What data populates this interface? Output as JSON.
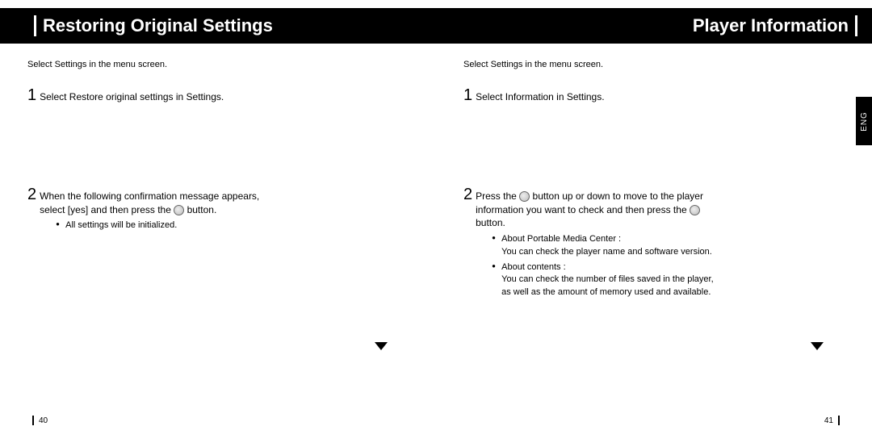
{
  "header": {
    "left_title": "Restoring Original Settings",
    "right_title": "Player Information"
  },
  "side_tab": "ENG",
  "left_page": {
    "intro": "Select Settings in the menu screen.",
    "step1_num": "1",
    "step1_text": "Select Restore original settings in Settings.",
    "step2_num": "2",
    "step2_text_a": "When the following confirmation message appears, select [yes] and then press the",
    "step2_text_b": "button.",
    "bullet1": "All settings will be initialized.",
    "pagenum": "40"
  },
  "right_page": {
    "intro": "Select Settings in the menu screen.",
    "step1_num": "1",
    "step1_text": "Select Information in Settings.",
    "step2_num": "2",
    "step2_text_a": "Press the",
    "step2_text_b": "button up or down to move to the player information you want to check and then press the",
    "step2_text_c": "button.",
    "bullet1_title": "About Portable Media Center :",
    "bullet1_body": "You can check the player name and software version.",
    "bullet2_title": "About contents :",
    "bullet2_body": "You can check the number of files saved in the player, as well as the amount of memory used and available.",
    "pagenum": "41"
  }
}
